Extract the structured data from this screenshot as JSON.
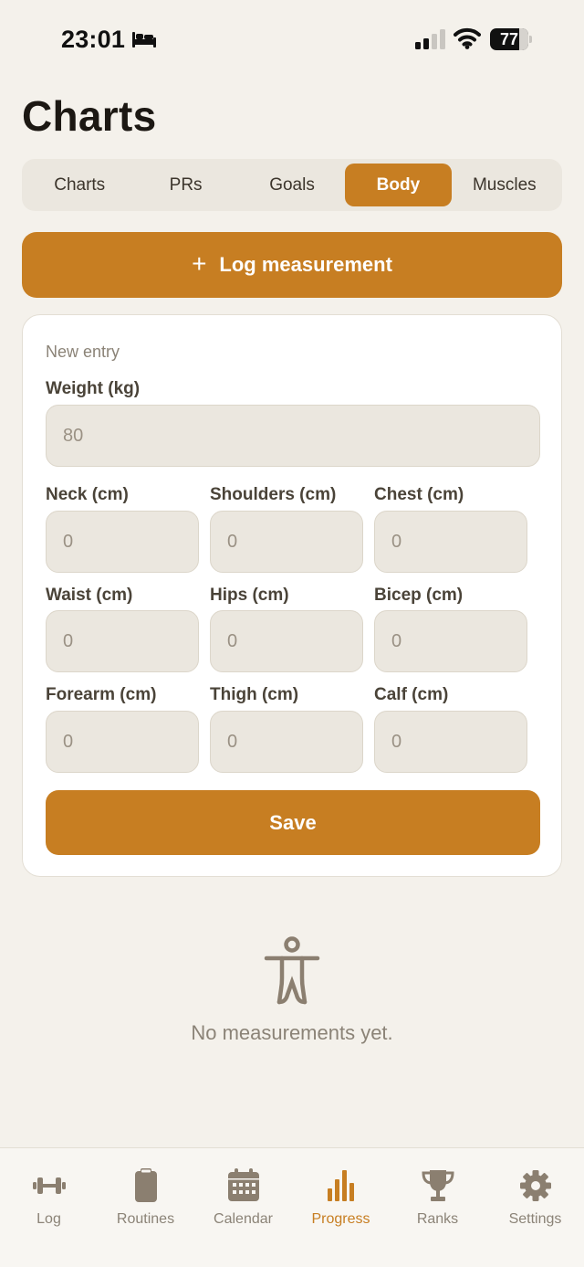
{
  "status_bar": {
    "time": "23:01",
    "battery_level": "77",
    "icons": [
      "bed-icon",
      "cellular-signal-icon",
      "wifi-icon",
      "battery-icon"
    ]
  },
  "page": {
    "title": "Charts"
  },
  "tabs": [
    {
      "label": "Charts",
      "active": false
    },
    {
      "label": "PRs",
      "active": false
    },
    {
      "label": "Goals",
      "active": false
    },
    {
      "label": "Body",
      "active": true
    },
    {
      "label": "Muscles",
      "active": false
    }
  ],
  "log_button": {
    "icon": "plus-icon",
    "label": "Log measurement"
  },
  "entry_form": {
    "caption": "New entry",
    "weight": {
      "label": "Weight (kg)",
      "placeholder": "80"
    },
    "fields": [
      {
        "label": "Neck (cm)",
        "placeholder": "0"
      },
      {
        "label": "Shoulders (cm)",
        "placeholder": "0"
      },
      {
        "label": "Chest (cm)",
        "placeholder": "0"
      },
      {
        "label": "Waist (cm)",
        "placeholder": "0"
      },
      {
        "label": "Hips (cm)",
        "placeholder": "0"
      },
      {
        "label": "Bicep (cm)",
        "placeholder": "0"
      },
      {
        "label": "Forearm (cm)",
        "placeholder": "0"
      },
      {
        "label": "Thigh (cm)",
        "placeholder": "0"
      },
      {
        "label": "Calf (cm)",
        "placeholder": "0"
      }
    ],
    "save_label": "Save"
  },
  "empty_state": {
    "icon": "body-figure-icon",
    "text": "No measurements yet."
  },
  "tabbar": [
    {
      "label": "Log",
      "icon": "dumbbell-icon",
      "active": false
    },
    {
      "label": "Routines",
      "icon": "clipboard-icon",
      "active": false
    },
    {
      "label": "Calendar",
      "icon": "calendar-icon",
      "active": false
    },
    {
      "label": "Progress",
      "icon": "bar-chart-icon",
      "active": true
    },
    {
      "label": "Ranks",
      "icon": "trophy-icon",
      "active": false
    },
    {
      "label": "Settings",
      "icon": "gear-icon",
      "active": false
    }
  ],
  "colors": {
    "accent": "#c77e22",
    "background": "#f4f1eb",
    "muted_text": "#8b8377",
    "input_fill": "#ebe7df"
  }
}
